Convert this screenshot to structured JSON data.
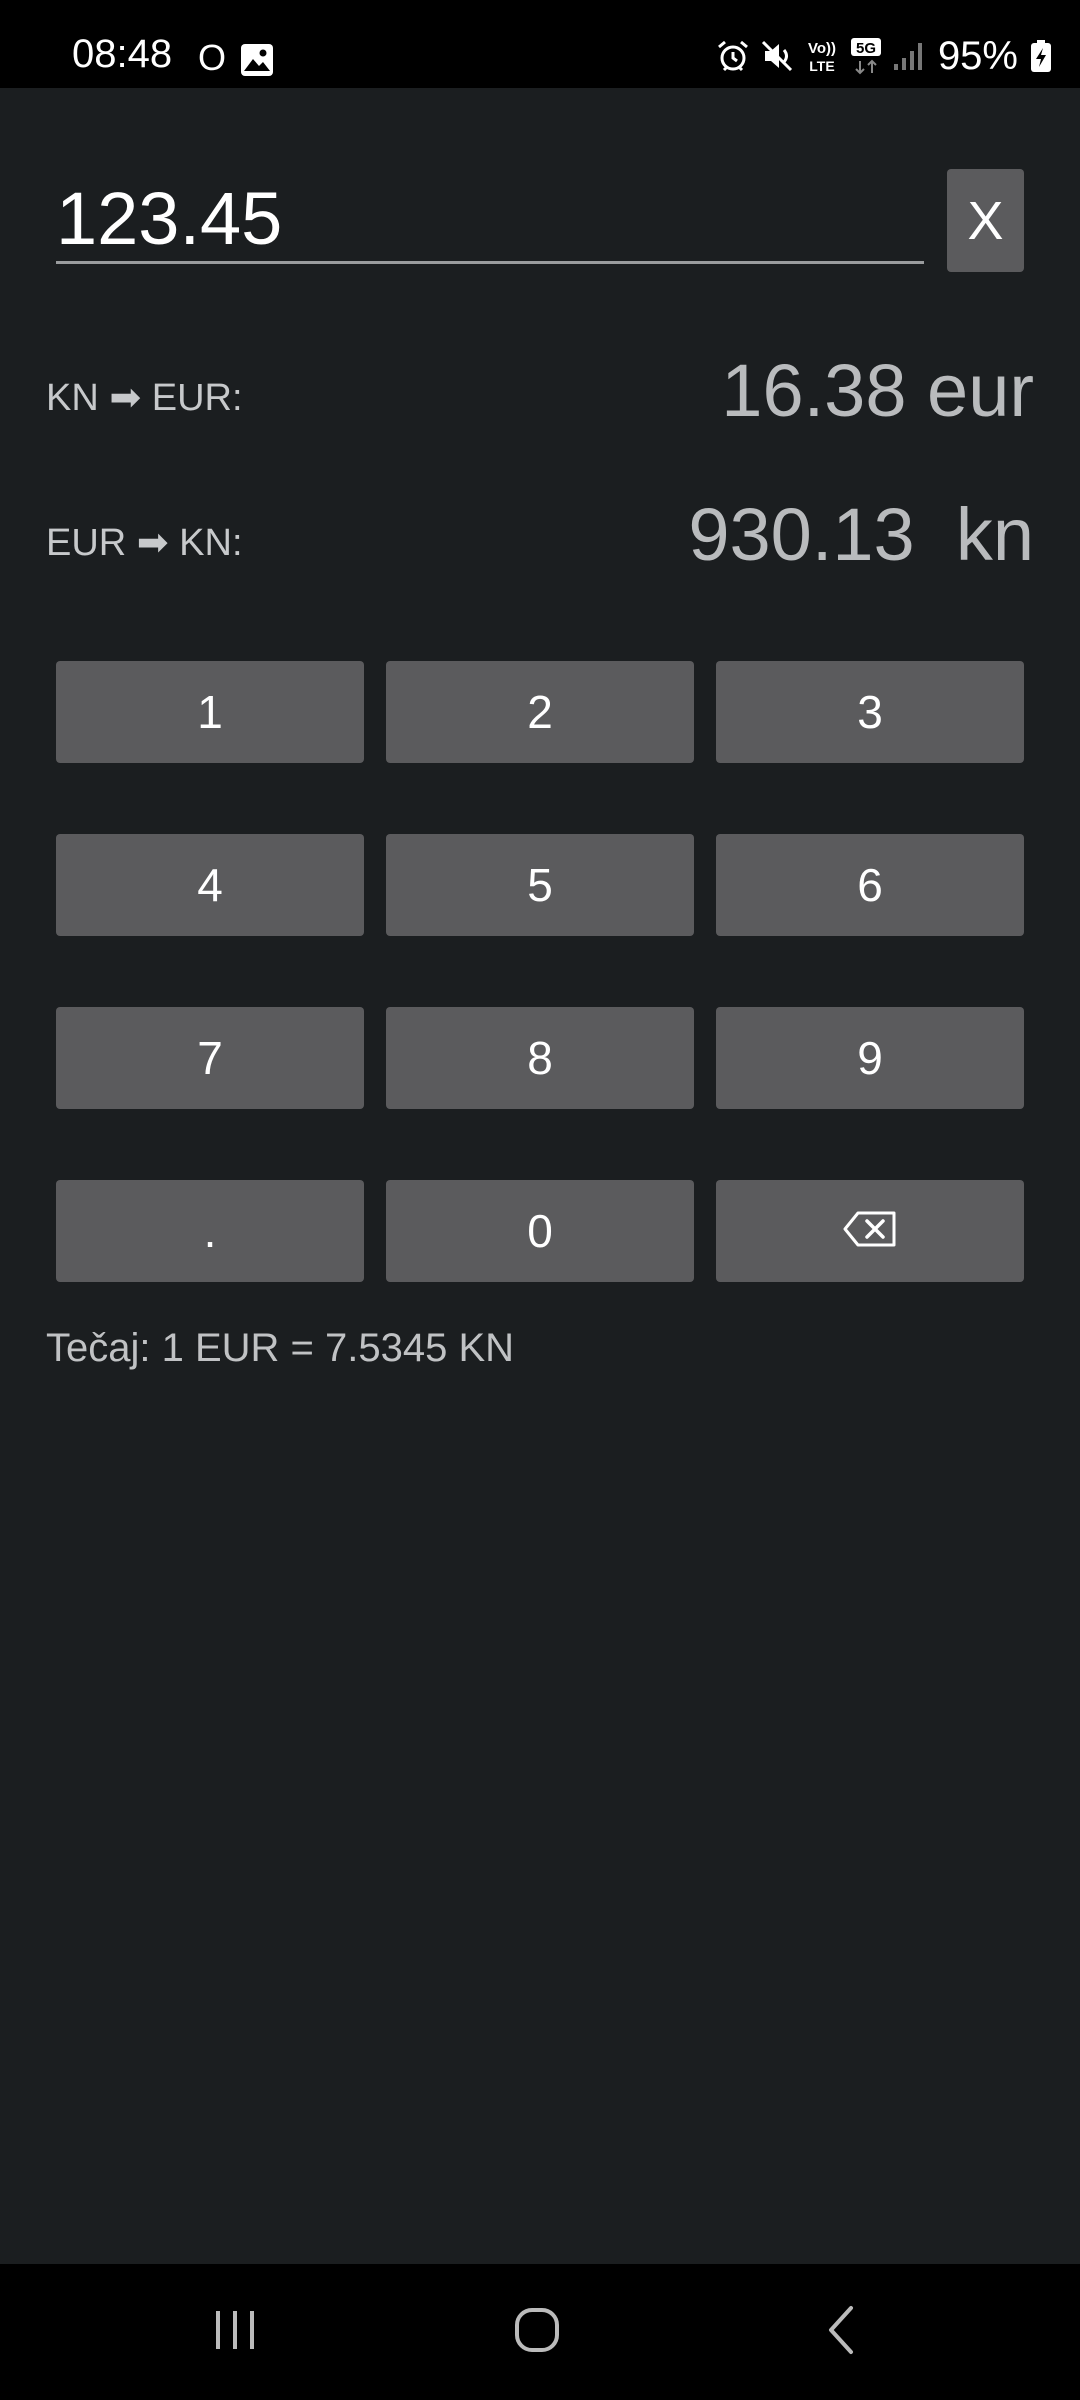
{
  "status_bar": {
    "time": "08:48",
    "notification": "O",
    "battery_percent": "95%",
    "icons": [
      "gallery-icon",
      "alarm-icon",
      "mute-icon",
      "volte-icon",
      "5g-icon",
      "signal-icon",
      "battery-charging-icon"
    ],
    "volte_label_top": "Vo))",
    "volte_label_bottom": "LTE",
    "network_label": "5G"
  },
  "input": {
    "value": "123.45",
    "clear_label": "X"
  },
  "conversions": [
    {
      "label": "KN ➡ EUR:",
      "value": "16.38 eur"
    },
    {
      "label": "EUR ➡ KN:",
      "value": "930.13  kn"
    }
  ],
  "keypad": {
    "keys": [
      "1",
      "2",
      "3",
      "4",
      "5",
      "6",
      "7",
      "8",
      "9",
      ".",
      "0"
    ],
    "backspace_icon": "backspace-icon"
  },
  "rate_text": "Tečaj: 1 EUR = 7.5345 KN",
  "nav_bar": {
    "icons": [
      "recent-apps-icon",
      "home-icon",
      "back-icon"
    ]
  },
  "colors": {
    "background": "#1b1e20",
    "button": "#5b5b5d",
    "bars": "#000000"
  }
}
